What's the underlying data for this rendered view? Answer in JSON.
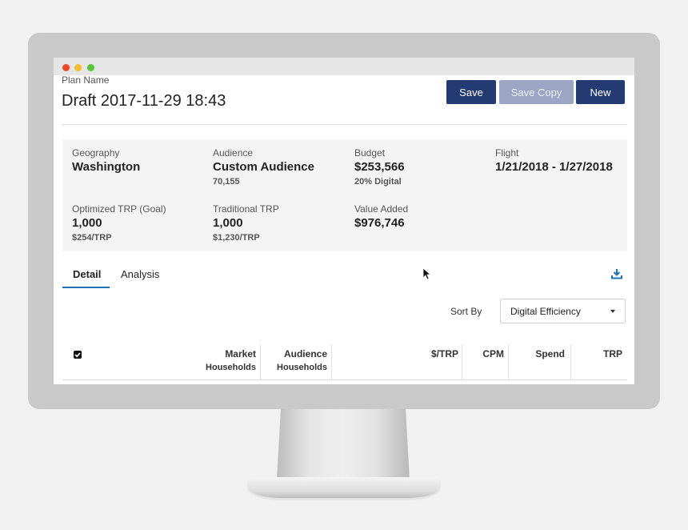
{
  "plan": {
    "label": "Plan Name",
    "title": "Draft 2017-11-29 18:43"
  },
  "toolbar": {
    "save_label": "Save",
    "save_copy_label": "Save Copy",
    "new_label": "New"
  },
  "summary": {
    "geography": {
      "label": "Geography",
      "value": "Washington"
    },
    "audience": {
      "label": "Audience",
      "value": "Custom Audience",
      "sub": "70,155"
    },
    "budget": {
      "label": "Budget",
      "value": "$253,566",
      "sub": "20% Digital"
    },
    "flight": {
      "label": "Flight",
      "value": "1/21/2018 - 1/27/2018"
    },
    "optimized_trp": {
      "label": "Optimized TRP (Goal)",
      "value": "1,000",
      "sub": "$254/TRP"
    },
    "traditional_trp": {
      "label": "Traditional TRP",
      "value": "1,000",
      "sub": "$1,230/TRP"
    },
    "value_added": {
      "label": "Value Added",
      "value": "$976,746"
    }
  },
  "tabs": [
    {
      "label": "Detail",
      "active": true
    },
    {
      "label": "Analysis",
      "active": false
    }
  ],
  "sort": {
    "label": "Sort By",
    "selected": "Digital Efficiency"
  },
  "table": {
    "columns": [
      {
        "line1": "Market",
        "line2": "Households"
      },
      {
        "line1": "Audience",
        "line2": "Households"
      },
      {
        "line1": "$/TRP",
        "line2": ""
      },
      {
        "line1": "CPM",
        "line2": ""
      },
      {
        "line1": "Spend",
        "line2": ""
      },
      {
        "line1": "TRP",
        "line2": ""
      }
    ]
  },
  "colors": {
    "primary": "#233a72",
    "primary_disabled": "#9aa6c4",
    "tab_accent": "#1e73b8",
    "summary_bg": "#f4f4f4"
  },
  "icons": [
    "checkbox-icon",
    "download-icon",
    "caret-down-icon",
    "cursor-icon"
  ]
}
